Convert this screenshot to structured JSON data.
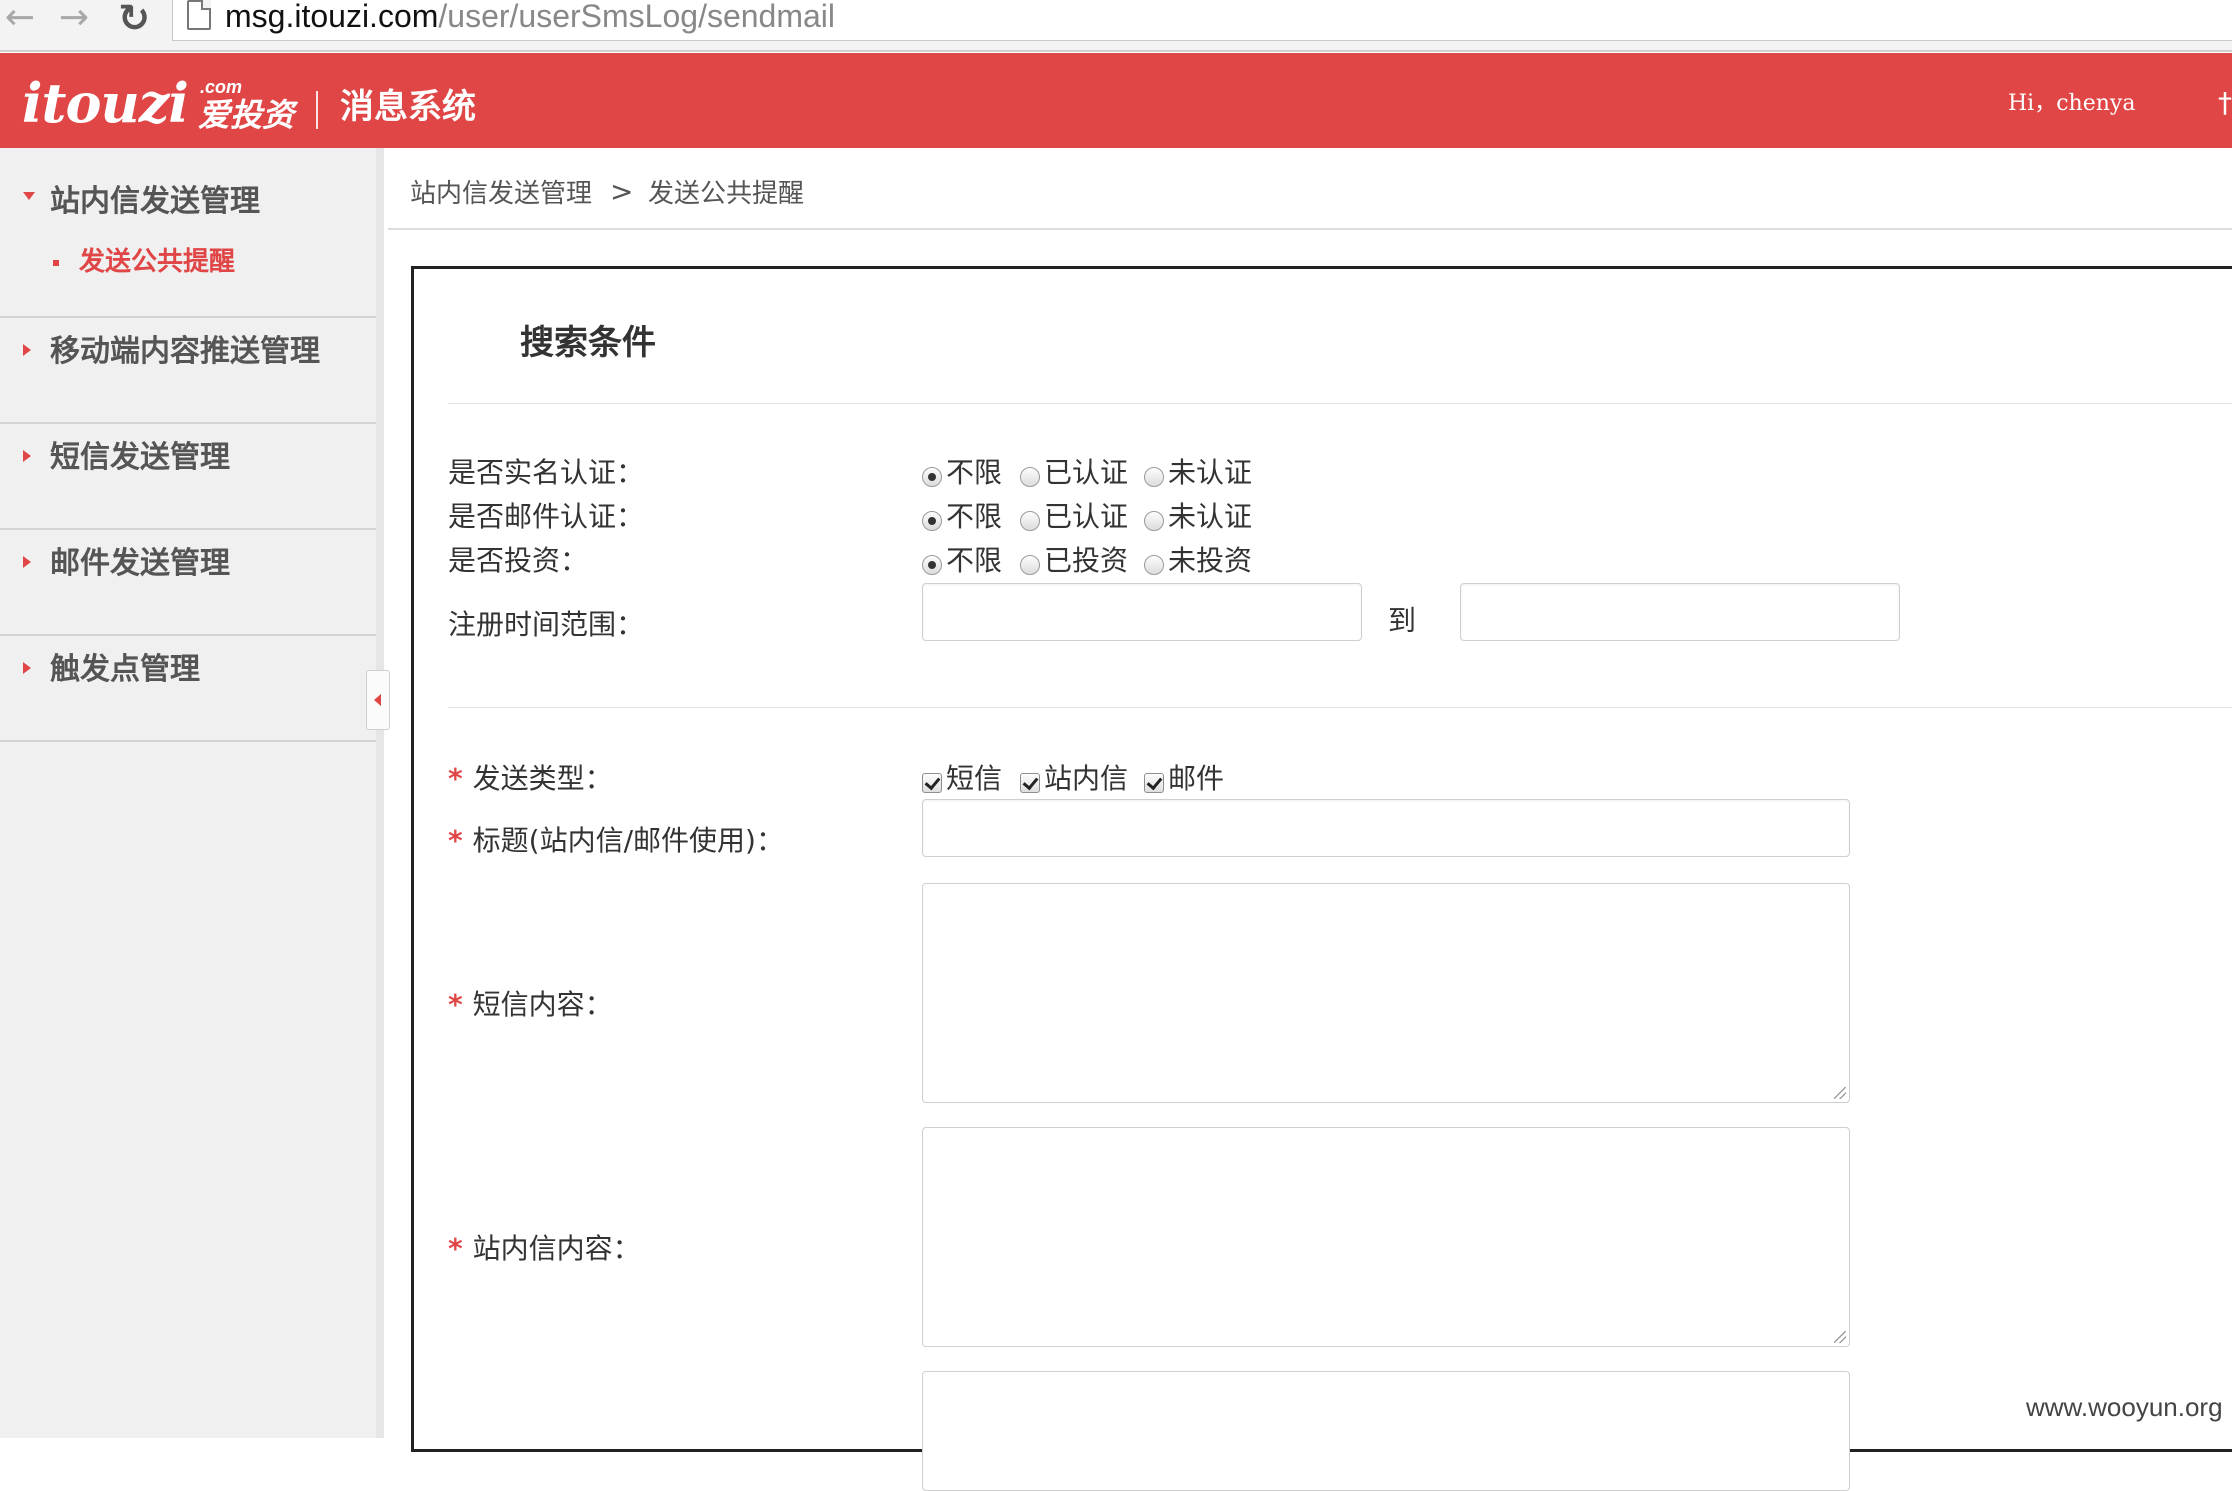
{
  "browser": {
    "url_host": "msg.itouzi.com",
    "url_path": "/user/userSmsLog/sendmail",
    "back_glyph": "←",
    "forward_glyph": "→",
    "reload_glyph": "↻",
    "icons": [
      "back-arrow-icon",
      "forward-arrow-icon",
      "reload-icon",
      "page-icon"
    ]
  },
  "header": {
    "logo_text": "itouzi",
    "logo_dotcom": ".com",
    "logo_cn": "爱投资",
    "title": "消息系统",
    "greeting": "Hi，chenya",
    "cut_text": "†",
    "bg_color": "#e04646"
  },
  "sidebar": {
    "groups": [
      {
        "label": "站内信发送管理",
        "expanded": true,
        "items": [
          {
            "label": "发送公共提醒",
            "active": true
          }
        ]
      },
      {
        "label": "移动端内容推送管理",
        "expanded": false
      },
      {
        "label": "短信发送管理",
        "expanded": false
      },
      {
        "label": "邮件发送管理",
        "expanded": false
      },
      {
        "label": "触发点管理",
        "expanded": false
      }
    ]
  },
  "breadcrumb": {
    "items": [
      "站内信发送管理",
      "发送公共提醒"
    ],
    "separator": ">"
  },
  "panel": {
    "title": "搜索条件",
    "filters": {
      "realname": {
        "label": "是否实名认证：",
        "options": [
          "不限",
          "已认证",
          "未认证"
        ],
        "selected": 0
      },
      "email": {
        "label": "是否邮件认证：",
        "options": [
          "不限",
          "已认证",
          "未认证"
        ],
        "selected": 0
      },
      "invest": {
        "label": "是否投资：",
        "options": [
          "不限",
          "已投资",
          "未投资"
        ],
        "selected": 0
      },
      "regtime": {
        "label": "注册时间范围：",
        "to_label": "到",
        "from_value": "",
        "to_value": ""
      }
    },
    "form": {
      "required_mark": "*",
      "send_type": {
        "label": "发送类型：",
        "options": [
          "短信",
          "站内信",
          "邮件"
        ],
        "checked": [
          true,
          true,
          true
        ]
      },
      "title_field": {
        "label": "标题(站内信/邮件使用)：",
        "value": ""
      },
      "sms_content": {
        "label": "短信内容：",
        "value": ""
      },
      "inbox_content": {
        "label": "站内信内容：",
        "value": ""
      }
    }
  },
  "watermark": "www.wooyun.org"
}
